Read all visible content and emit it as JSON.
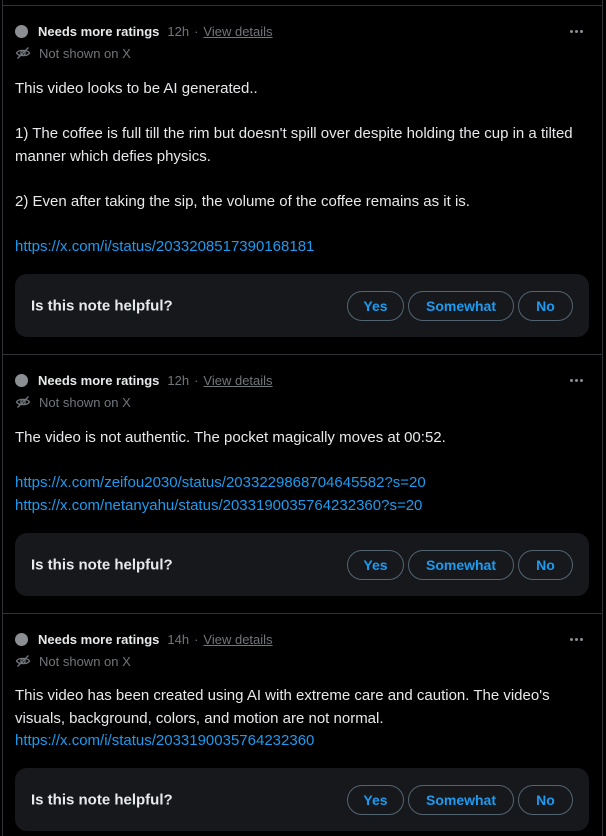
{
  "rating_prompt": "Is this note helpful?",
  "buttons": {
    "yes": "Yes",
    "somewhat": "Somewhat",
    "no": "No"
  },
  "notes": [
    {
      "status": "Needs more ratings",
      "age": "12h",
      "separator": "·",
      "details_link": "View details",
      "visibility": "Not shown on X",
      "paragraphs": [
        "This video looks to be AI generated..",
        "1) The coffee is full till the rim but doesn't spill over despite holding the cup in a tilted manner which defies physics.",
        "2) Even after taking the sip, the volume of the coffee remains as it is."
      ],
      "links": [
        "https://x.com/i/status/2033208517390168181"
      ]
    },
    {
      "status": "Needs more ratings",
      "age": "12h",
      "separator": "·",
      "details_link": "View details",
      "visibility": "Not shown on X",
      "paragraphs": [
        "The video is not authentic. The pocket magically moves at 00:52."
      ],
      "links": [
        "https://x.com/zeifou2030/status/2033229868704645582?s=20",
        "https://x.com/netanyahu/status/2033190035764232360?s=20"
      ]
    },
    {
      "status": "Needs more ratings",
      "age": "14h",
      "separator": "·",
      "details_link": "View details",
      "visibility": "Not shown on X",
      "paragraphs": [
        "This video has been created using AI with extreme care and caution. The video's visuals, background, colors, and motion are not normal."
      ],
      "links": [
        "https://x.com/i/status/2033190035764232360"
      ]
    }
  ],
  "colors": {
    "background": "#000000",
    "link": "#1d9bf0",
    "muted": "#71767b",
    "panel": "#16181c",
    "border": "#2f3336"
  },
  "icons": {
    "status": "status-dot-icon",
    "visibility": "eye-off-icon",
    "menu": "more-dots-icon"
  }
}
